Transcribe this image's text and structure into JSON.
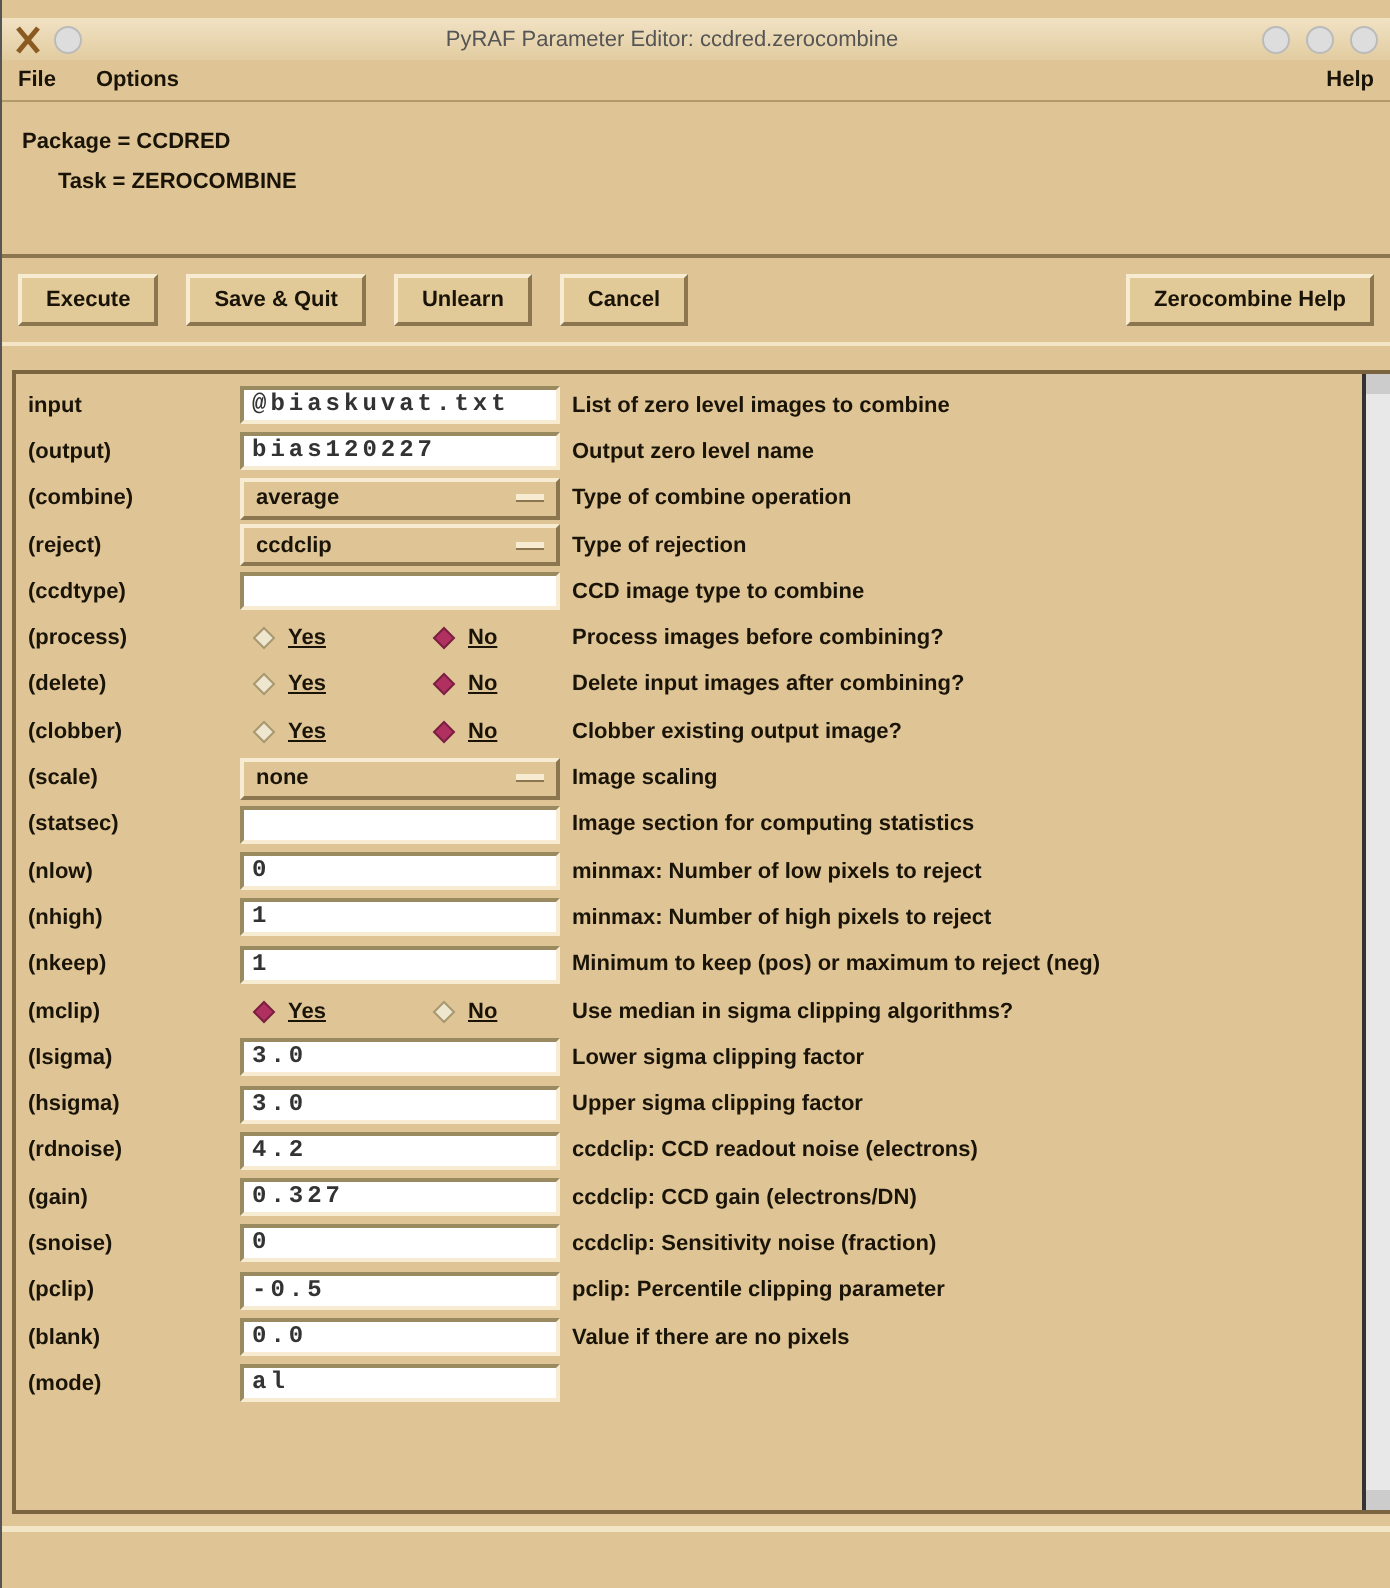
{
  "window": {
    "title": "PyRAF Parameter Editor:  ccdred.zerocombine"
  },
  "menu": {
    "left": [
      "File",
      "Options"
    ],
    "right": "Help"
  },
  "header": {
    "package": "Package = CCDRED",
    "task": "Task = ZEROCOMBINE"
  },
  "buttons": [
    "Execute",
    "Save & Quit",
    "Unlearn",
    "Cancel"
  ],
  "help_button": "Zerocombine Help",
  "params": [
    {
      "kind": "text",
      "name": "input",
      "value": "@biaskuvat.txt",
      "description": "List of zero level images to combine"
    },
    {
      "kind": "text",
      "name": "(output)",
      "value": "bias120227",
      "description": "Output zero level name"
    },
    {
      "kind": "menu",
      "name": "(combine)",
      "value": "average",
      "description": "Type of combine operation"
    },
    {
      "kind": "menu",
      "name": "(reject)",
      "value": "ccdclip",
      "description": "Type of rejection"
    },
    {
      "kind": "text",
      "name": "(ccdtype)",
      "description": "CCD image type to combine"
    },
    {
      "kind": "radio",
      "name": "(process)",
      "options": [
        {
          "label": "Yes",
          "selected": false
        },
        {
          "label": "No",
          "selected": true
        }
      ],
      "description": "Process images before combining?"
    },
    {
      "kind": "radio",
      "name": "(delete)",
      "options": [
        {
          "label": "Yes",
          "selected": false
        },
        {
          "label": "No",
          "selected": true
        }
      ],
      "description": "Delete input images after combining?"
    },
    {
      "kind": "radio",
      "name": "(clobber)",
      "options": [
        {
          "label": "Yes",
          "selected": false
        },
        {
          "label": "No",
          "selected": true
        }
      ],
      "description": "Clobber existing output image?"
    },
    {
      "kind": "menu",
      "name": "(scale)",
      "value": "none",
      "description": "Image scaling"
    },
    {
      "kind": "text",
      "name": "(statsec)",
      "description": "Image section for computing statistics"
    },
    {
      "kind": "text",
      "name": "(nlow)",
      "value": "0",
      "description": "minmax: Number of low pixels to reject"
    },
    {
      "kind": "text",
      "name": "(nhigh)",
      "value": "1",
      "description": "minmax: Number of high pixels to reject"
    },
    {
      "kind": "text",
      "name": "(nkeep)",
      "value": "1",
      "description": "Minimum to keep (pos) or maximum to reject (neg)"
    },
    {
      "kind": "radio",
      "name": "(mclip)",
      "options": [
        {
          "label": "Yes",
          "selected": true
        },
        {
          "label": "No",
          "selected": false
        }
      ],
      "description": "Use median in sigma clipping algorithms?"
    },
    {
      "kind": "text",
      "name": "(lsigma)",
      "value": "3.0",
      "description": "Lower sigma clipping factor"
    },
    {
      "kind": "text",
      "name": "(hsigma)",
      "value": "3.0",
      "description": "Upper sigma clipping factor"
    },
    {
      "kind": "text",
      "name": "(rdnoise)",
      "value": "4.2",
      "description": "ccdclip: CCD readout noise (electrons)"
    },
    {
      "kind": "text",
      "name": "(gain)",
      "value": "0.327",
      "description": "ccdclip: CCD gain (electrons/DN)"
    },
    {
      "kind": "text",
      "name": "(snoise)",
      "value": "0",
      "description": "ccdclip: Sensitivity noise (fraction)"
    },
    {
      "kind": "text",
      "name": "(pclip)",
      "value": "-0.5",
      "description": "pclip: Percentile clipping parameter"
    },
    {
      "kind": "text",
      "name": "(blank)",
      "value": "0.0",
      "description": "Value if there are no pixels"
    },
    {
      "kind": "text",
      "name": "(mode)",
      "value": "al"
    }
  ]
}
